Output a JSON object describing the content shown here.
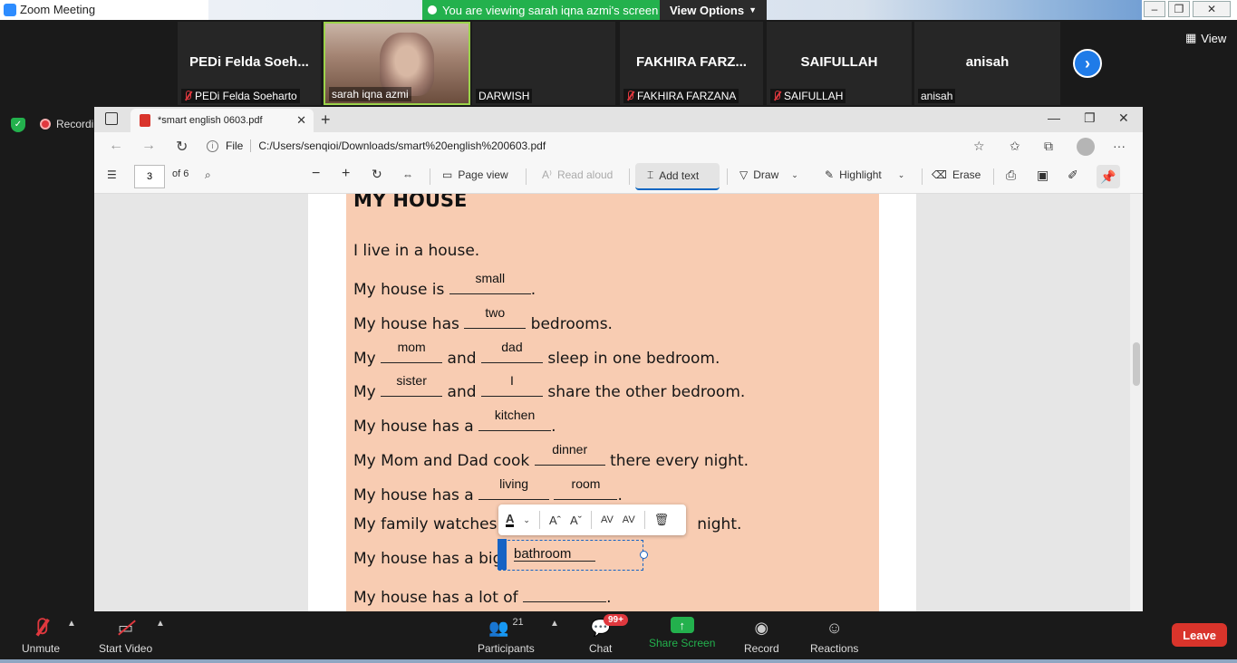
{
  "zoom": {
    "window_title": "Zoom Meeting",
    "viewing_banner": "You are viewing sarah iqna azmi's screen",
    "view_options": "View Options",
    "view_label": "View",
    "recording": "Recording",
    "participants": [
      {
        "display": "PEDi Felda Soeh...",
        "name": "PEDi Felda Soeharto",
        "muted": true
      },
      {
        "display": "",
        "name": "sarah iqna azmi",
        "muted": false,
        "video": true
      },
      {
        "display": "",
        "name": "DARWISH",
        "muted": false
      },
      {
        "display": "FAKHIRA FARZ...",
        "name": "FAKHIRA FARZANA",
        "muted": true
      },
      {
        "display": "SAIFULLAH",
        "name": "SAIFULLAH",
        "muted": true
      },
      {
        "display": "anisah",
        "name": "anisah",
        "muted": false
      }
    ],
    "bottom": {
      "unmute": "Unmute",
      "start_video": "Start Video",
      "participants_label": "Participants",
      "participants_count": "21",
      "chat": "Chat",
      "chat_badge": "99+",
      "share_screen": "Share Screen",
      "record": "Record",
      "reactions": "Reactions",
      "leave": "Leave"
    }
  },
  "browser": {
    "tab_title": "*smart english 0603.pdf",
    "address_scheme": "File",
    "address_url": "C:/Users/senqioi/Downloads/smart%20english%200603.pdf"
  },
  "pdf_toolbar": {
    "page_number": "3",
    "page_total": "of 6",
    "page_view": "Page view",
    "read_aloud": "Read aloud",
    "add_text": "Add text",
    "draw": "Draw",
    "highlight": "Highlight",
    "erase": "Erase"
  },
  "worksheet": {
    "heading": "MY HOUSE",
    "lines": {
      "l1": "I live in a house.",
      "l2_a": "My house is",
      "l2_fill": "small",
      "l2_b": ".",
      "l3_a": "My house has",
      "l3_fill": "two",
      "l3_b": "bedrooms.",
      "l4_a": "My",
      "l4_fill1": "mom",
      "l4_mid": "and",
      "l4_fill2": "dad",
      "l4_b": "sleep in one bedroom.",
      "l5_a": "My",
      "l5_fill1": "sister",
      "l5_mid": "and",
      "l5_fill2": "I",
      "l5_b": "share the other bedroom.",
      "l6_a": "My house has a",
      "l6_fill": "kitchen",
      "l6_b": ".",
      "l7_a": "My Mom and Dad cook",
      "l7_fill": "dinner",
      "l7_b": "there every night.",
      "l8_a": "My house has a",
      "l8_fill1": "living",
      "l8_fill2": "room",
      "l8_b": ".",
      "l9_a": "My family watches",
      "l9_b": "night.",
      "l10_a": "My house has a big",
      "l11_a": "My house has a lot of",
      "l11_b": "."
    },
    "active_text": "bathroom"
  }
}
